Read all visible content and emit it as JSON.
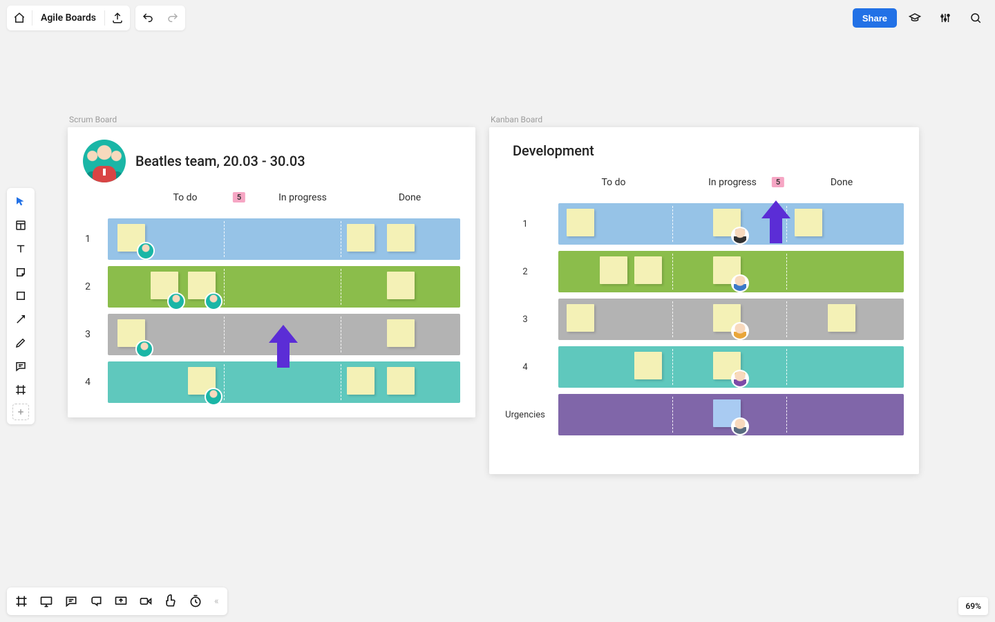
{
  "header": {
    "projectTitle": "Agile Boards",
    "shareLabel": "Share"
  },
  "canvas": {
    "scrumLabel": "Scrum Board",
    "kanbanLabel": "Kanban Board",
    "zoom": "69%"
  },
  "scrum": {
    "title": "Beatles team, 20.03 - 30.03",
    "columns": {
      "todo": "To do",
      "inprogress": "In progress",
      "done": "Done"
    },
    "badge": "5",
    "rows": {
      "r1": "1",
      "r2": "2",
      "r3": "3",
      "r4": "4"
    }
  },
  "kanban": {
    "title": "Development",
    "columns": {
      "todo": "To do",
      "inprogress": "In progress",
      "done": "Done"
    },
    "badge": "5",
    "rows": {
      "r1": "1",
      "r2": "2",
      "r3": "3",
      "r4": "4",
      "urg": "Urgencies"
    }
  }
}
